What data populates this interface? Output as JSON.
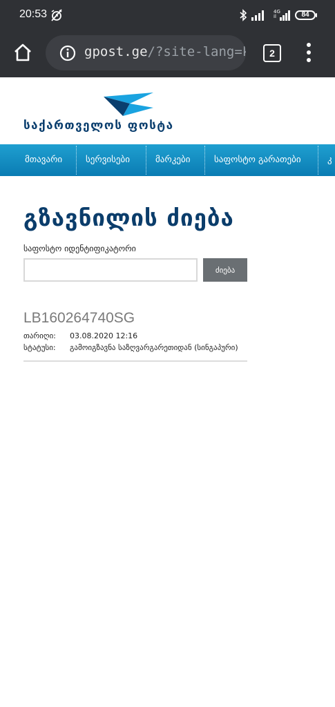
{
  "status_bar": {
    "time": "20:53",
    "network_top": "4G",
    "network_bottom": "il",
    "battery": "84"
  },
  "browser": {
    "url_domain": "gpost.ge",
    "url_path": "/?site-lang=ka",
    "tab_count": "2"
  },
  "site": {
    "logo_text": "საქართველოს ფოსტა",
    "nav_items": [
      "მთავარი",
      "სერვისები",
      "მარკები",
      "საფოსტო გარათები",
      "კ"
    ]
  },
  "main": {
    "title": "გზავნილის ძიება",
    "id_label": "საფოსტო იდენტიფიკატორი",
    "search_label": "ძიება",
    "tracking_number": "LB160264740SG",
    "details": {
      "date_label": "თარიღი:",
      "date_value": "03.08.2020 12:16",
      "status_label": "სტატუსი:",
      "status_value": "გამოიგზავნა საზღვარგარეთიდან (სინგაპური)"
    }
  },
  "colors": {
    "chrome_dark": "#2f3135",
    "nav_blue": "#0a7cb3",
    "title_navy": "#0b3d6b",
    "logo_blue": "#1aa3e0"
  }
}
